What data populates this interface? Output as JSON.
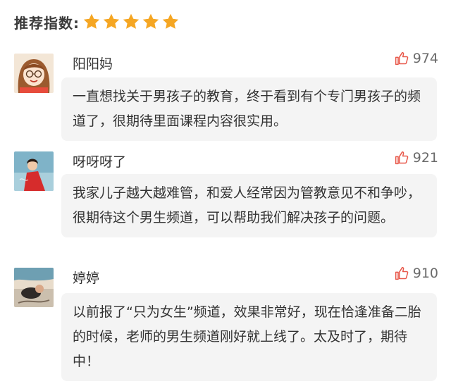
{
  "rating": {
    "label": "推荐指数:",
    "stars": 5,
    "star_color": "#f5a623",
    "star_icon": "star-icon"
  },
  "comments": [
    {
      "username": "阳阳妈",
      "likes": "974",
      "text": "一直想找关于男孩子的教育，终于看到有个专门男孩子的频道了，很期待里面课程内容很实用。",
      "avatar_icon": "cartoon-girl-avatar"
    },
    {
      "username": "呀呀呀了",
      "likes": "921",
      "text": "我家儿子越大越难管，和爱人经常因为管教意见不和争吵，很期待这个男生频道，可以帮助我们解决孩子的问题。",
      "avatar_icon": "girl-in-red-avatar"
    },
    {
      "username": "婷婷",
      "likes": "910",
      "text": "以前报了“只为女生”频道，效果非常好，现在恰逢准备二胎的时候，老师的男生频道刚好就上线了。太及时了，期待中！",
      "avatar_icon": "beach-photo-avatar"
    }
  ],
  "like_icon": "thumbs-up-icon",
  "like_color": "#e8584a"
}
